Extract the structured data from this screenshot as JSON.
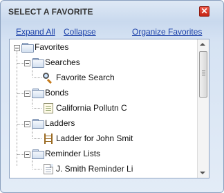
{
  "dialog": {
    "title": "SELECT A FAVORITE",
    "close_label": "✕"
  },
  "toolbar": {
    "expand_all": "Expand All",
    "collapse": "Collapse",
    "organize": "Organize Favorites"
  },
  "tree": {
    "root": "Favorites",
    "groups": [
      {
        "label": "Searches",
        "child": "Favorite Search",
        "child_icon": "magnifier-icon"
      },
      {
        "label": "Bonds",
        "child": "California Pollutn C",
        "child_icon": "bond-certificate-icon"
      },
      {
        "label": "Ladders",
        "child": "Ladder for John Smit",
        "child_icon": "ladder-icon"
      },
      {
        "label": "Reminder Lists",
        "child": "J. Smith Reminder Li",
        "child_icon": "document-icon"
      }
    ]
  },
  "colors": {
    "link": "#1a3fa8",
    "close_button": "#d43a2a",
    "panel_background": "#d6e3f3"
  }
}
